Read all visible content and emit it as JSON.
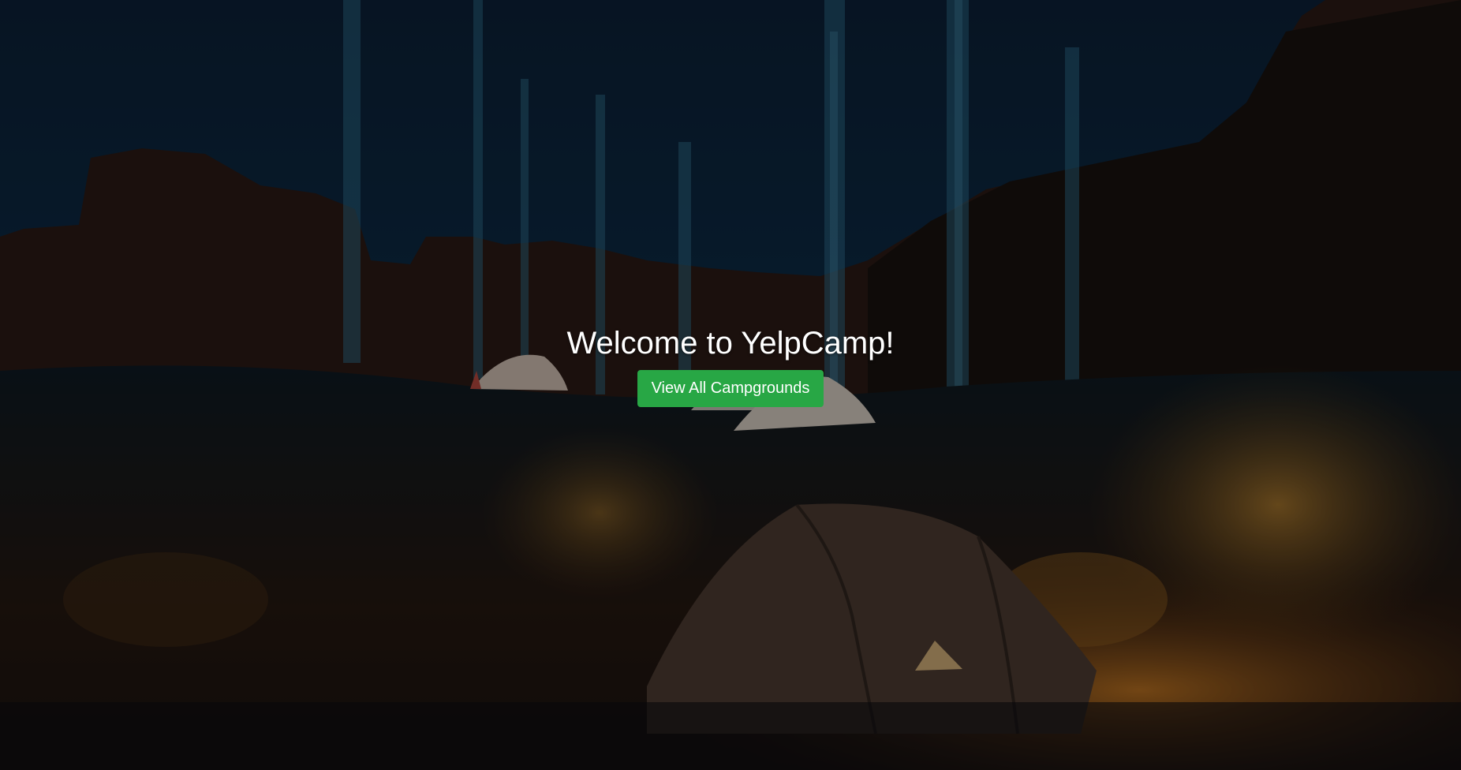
{
  "hero": {
    "title": "Welcome to YelpCamp!",
    "button_label": "View All Campgrounds"
  },
  "colors": {
    "button_bg": "#28a745",
    "sky": "#0c2136",
    "ground": "#2b1c14",
    "firelight": "#d9892a"
  },
  "background": {
    "description_icon": "campsite-night-photo"
  }
}
